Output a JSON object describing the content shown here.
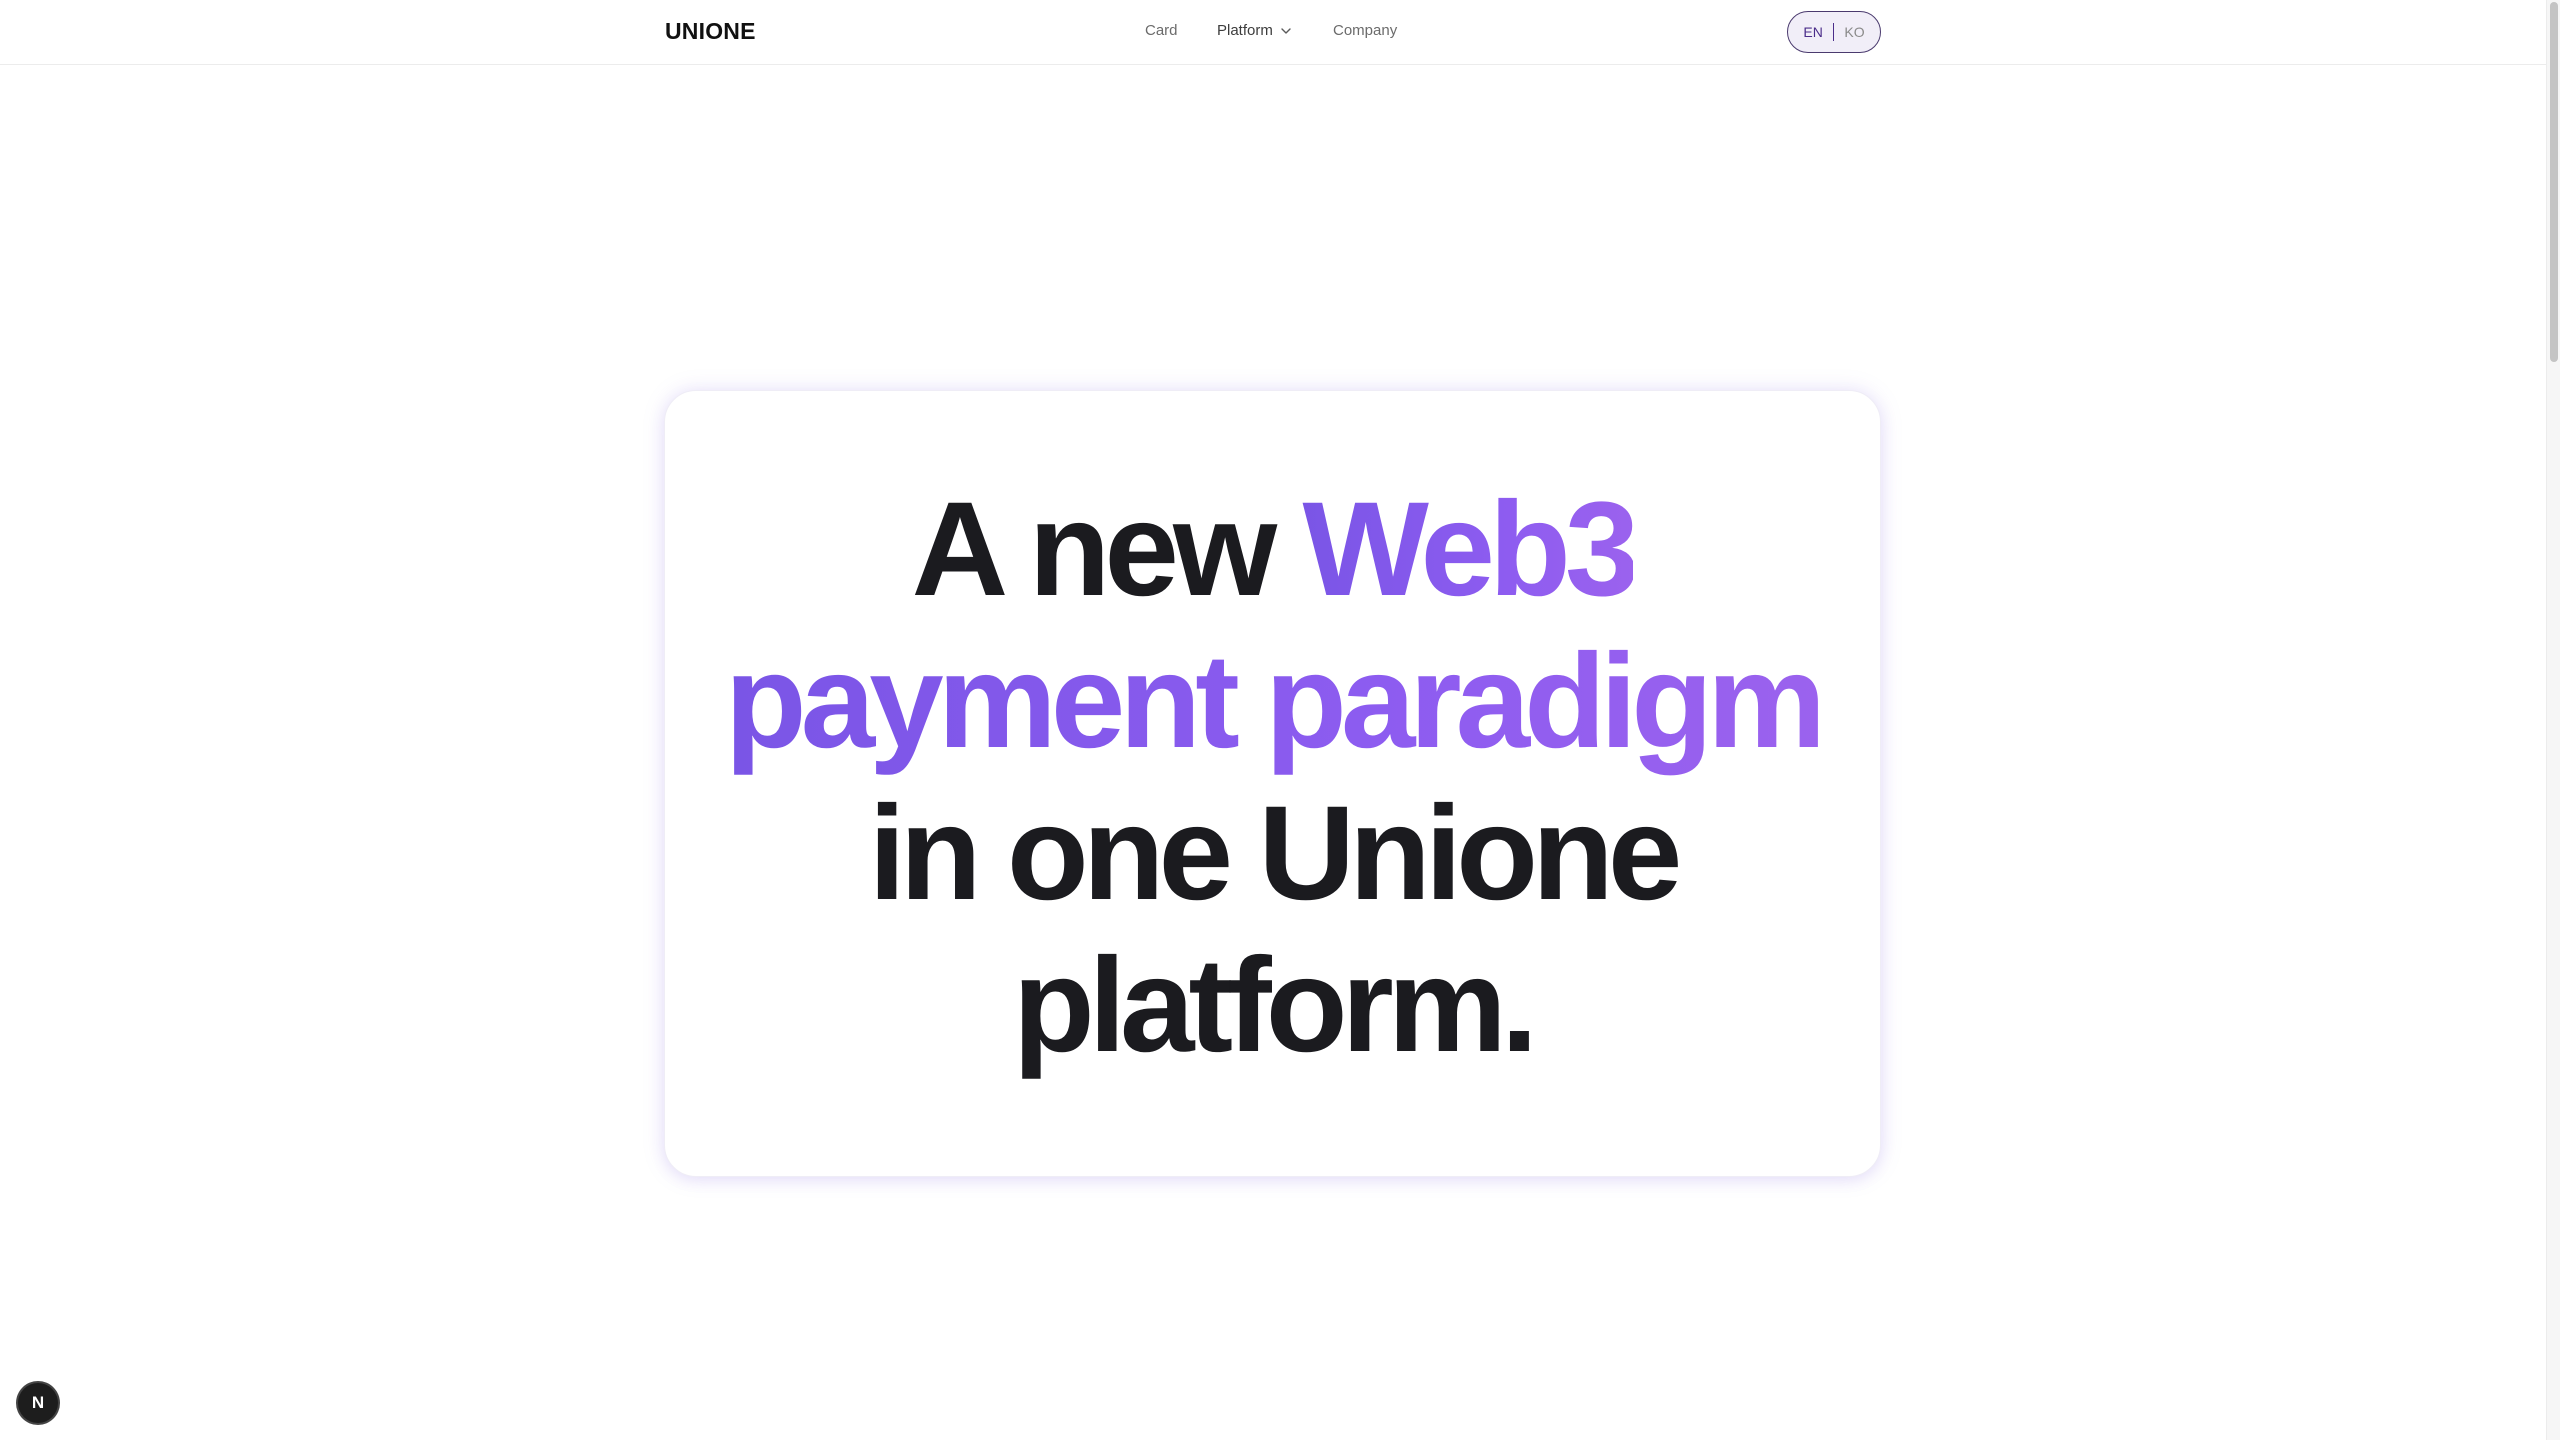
{
  "header": {
    "logo": "UNIONE",
    "nav": {
      "card": "Card",
      "platform": "Platform",
      "company": "Company"
    },
    "lang": {
      "en": "EN",
      "ko": "KO"
    }
  },
  "hero": {
    "line1_plain": "A new ",
    "line1_accent": "Web3",
    "line2_accent": "payment paradigm",
    "line3_plain": "in one Unione",
    "line4_plain": "platform."
  },
  "dev_badge": {
    "letter": "N"
  },
  "colors": {
    "accent": "#8a5cf0",
    "text": "#1b1b1f",
    "lang_border": "#4a3a6e"
  }
}
